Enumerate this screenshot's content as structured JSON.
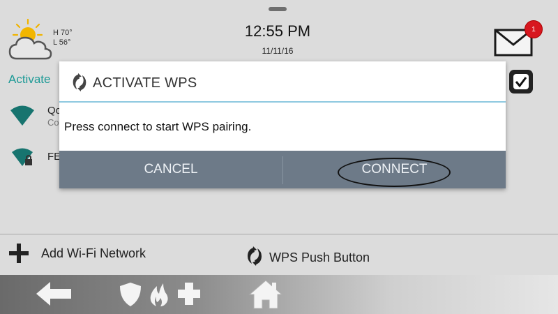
{
  "status_bar": {
    "weather": {
      "high": "H 70°",
      "low": "L 56°",
      "icon": "partly-cloudy-icon"
    },
    "time": "12:55 PM",
    "date": "11/11/16",
    "messages": {
      "icon": "mail-icon",
      "count": "1"
    }
  },
  "wifi": {
    "header": "Activate",
    "enabled_icon": "checkbox-checked-icon",
    "networks": [
      {
        "name": "Qo",
        "status": "Co",
        "icon": "wifi-signal-icon",
        "secured": false
      },
      {
        "name": "FE",
        "status": "",
        "icon": "wifi-locked-icon",
        "secured": true
      }
    ]
  },
  "actions": {
    "add_network": "Add Wi-Fi Network",
    "wps_push": "WPS Push Button"
  },
  "dialog": {
    "title": "ACTIVATE WPS",
    "message": "Press connect to start WPS pairing.",
    "cancel_label": "CANCEL",
    "connect_label": "CONNECT"
  },
  "bottom_nav": {
    "icons": [
      "back-arrow-icon",
      "shield-icon",
      "fire-icon",
      "medical-cross-icon",
      "home-icon"
    ]
  },
  "colors": {
    "accent": "#1d9a96",
    "dialog_button_bar": "#6d7a88",
    "badge": "#d7171f",
    "dialog_rule": "#8ec9e0"
  }
}
